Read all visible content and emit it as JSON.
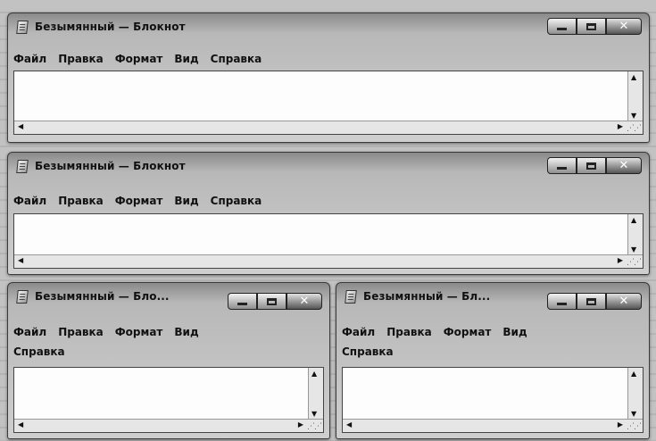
{
  "windows": [
    {
      "title": "Безымянный — Блокнот",
      "menu": [
        "Файл",
        "Правка",
        "Формат",
        "Вид",
        "Справка"
      ]
    },
    {
      "title": "Безымянный — Блокнот",
      "menu": [
        "Файл",
        "Правка",
        "Формат",
        "Вид",
        "Справка"
      ]
    },
    {
      "title": "Безымянный — Бло...",
      "menu": [
        "Файл",
        "Правка",
        "Формат",
        "Вид",
        "Справка"
      ]
    },
    {
      "title": "Безымянный — Бл...",
      "menu": [
        "Файл",
        "Правка",
        "Формат",
        "Вид",
        "Справка"
      ]
    }
  ],
  "icons": {
    "app": "notepad-icon",
    "minimize": "minimize-icon",
    "maximize": "maximize-icon",
    "close": "close-icon",
    "scroll_up": "arrow-up-icon",
    "scroll_down": "arrow-down-icon",
    "scroll_left": "arrow-left-icon",
    "scroll_right": "arrow-right-icon"
  }
}
